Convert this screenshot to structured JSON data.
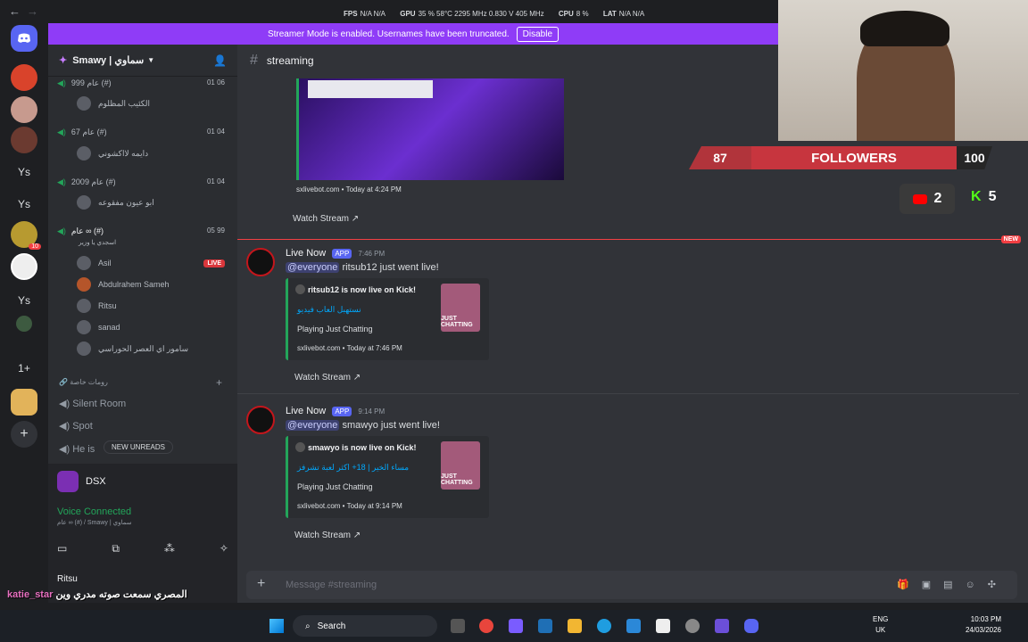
{
  "titlebar": {
    "back": "←",
    "forward": "→"
  },
  "perf": {
    "fps_label": "FPS",
    "fps_value": "N/A N/A",
    "gpu_label": "GPU",
    "gpu_value": "35 % 58°C 2295 MHz 0.830 V 405 MHz",
    "cpu_label": "CPU",
    "cpu_value": "8 %",
    "lat_label": "LAT",
    "lat_value": "N/A N/A"
  },
  "banner": {
    "text": "Streamer Mode is enabled. Usernames have been truncated.",
    "button": "Disable"
  },
  "server": {
    "name": "Smawy | سماوي"
  },
  "rail": {
    "ys1": "Ys",
    "ys2": "Ys",
    "ys3": "Ys",
    "badge": "10",
    "plus_count": "1+"
  },
  "voice_channels": [
    {
      "name": "عام 999 (#)",
      "count": "01 06",
      "member": "الكئيب المظلوم"
    },
    {
      "name": "عام 67 (#)",
      "count": "01 04",
      "member": "دايمه لااكشوني"
    },
    {
      "name": "عام 2009 (#)",
      "count": "01 04",
      "member": "ابو عيون مفقوعه"
    },
    {
      "name": "عام ∞ (#)",
      "count": "05 99",
      "sub": "اسجدي يا وزير"
    }
  ],
  "members": [
    {
      "name": "Asil",
      "live": "LIVE"
    },
    {
      "name": "Abdulrahem Sameh"
    },
    {
      "name": "Ritsu"
    },
    {
      "name": "sanad"
    },
    {
      "name": "سامور اي العصر الحوراسي"
    }
  ],
  "category": {
    "name": "رومات خاصة"
  },
  "text_channels": [
    "Silent Room",
    "Spot",
    "He is"
  ],
  "new_unreads": "NEW UNREADS",
  "panel": {
    "activity": "DSX",
    "voice_status": "Voice Connected",
    "voice_sub": "عام ∞ (#) / Smawy | سماوي",
    "user": "Ritsu"
  },
  "caption": {
    "name": "katie_star",
    "text": "المصري سمعت صوته مدري وين"
  },
  "channel": {
    "name": "streaming"
  },
  "first_embed": {
    "footer": "sxlivebot.com • Today at 4:24 PM",
    "watch": "Watch Stream"
  },
  "messages": [
    {
      "author": "Live Now",
      "tag": "APP",
      "time": "7:46 PM",
      "mention": "@everyone",
      "text": "ritsub12 just went live!",
      "embed_title": "ritsub12 is now live on Kick!",
      "embed_sub": "نستهبل العاب فيديو",
      "embed_play": "Playing Just Chatting",
      "embed_thumb": "JUST CHATTING",
      "embed_footer": "sxlivebot.com • Today at 7:46 PM",
      "watch": "Watch Stream"
    },
    {
      "author": "Live Now",
      "tag": "APP",
      "time": "9:14 PM",
      "mention": "@everyone",
      "text": "smawyo just went live!",
      "embed_title": "smawyo is now live on Kick!",
      "embed_sub": "مساء الخير | 18+ اكثر لعبة تشرفز",
      "embed_play": "Playing Just Chatting",
      "embed_thumb": "JUST CHATTING",
      "embed_footer": "sxlivebot.com • Today at 9:14 PM",
      "watch": "Watch Stream"
    }
  ],
  "new_tag": "NEW",
  "composer": {
    "placeholder": "Message #streaming"
  },
  "overlay": {
    "followers_current": "87",
    "followers_label": "FOLLOWERS",
    "followers_goal": "100",
    "youtube_count": "2",
    "kick_count": "5"
  },
  "taskbar": {
    "search": "Search",
    "lang1": "ENG",
    "lang2": "UK",
    "time": "10:03 PM",
    "date": "24/03/2026"
  },
  "colors": {
    "banner": "#8f3cf7",
    "live": "#da373c",
    "voice": "#23a55a",
    "link": "#00a8fc",
    "followers": "#c7353e"
  }
}
